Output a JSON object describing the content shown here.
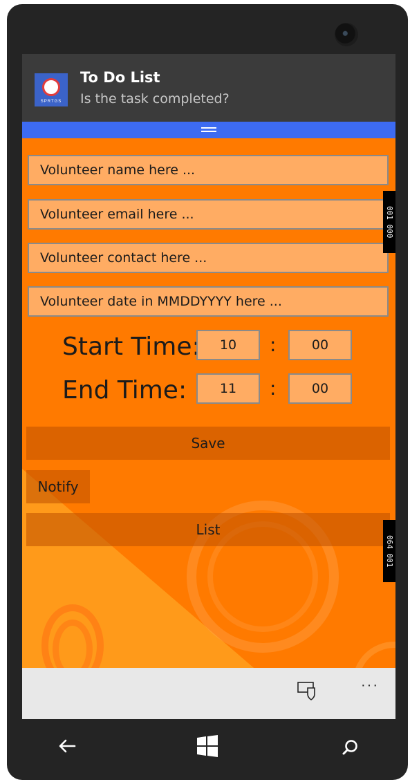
{
  "notification": {
    "title": "To Do List",
    "message": "Is the task completed?",
    "logo_text": "SPRTGS"
  },
  "form": {
    "name_placeholder": "Volunteer name here ...",
    "email_placeholder": "Volunteer email here ...",
    "contact_placeholder": "Volunteer contact here ...",
    "date_placeholder": "Volunteer date in MMDDYYYY here ...",
    "start_label": "Start Time:",
    "end_label": "End Time:",
    "start_hour": "10",
    "start_minute": "00",
    "end_hour": "11",
    "end_minute": "00",
    "separator": ":"
  },
  "buttons": {
    "save": "Save",
    "notify": "Notify",
    "list": "List"
  },
  "debug_counters": {
    "top": "001 000",
    "bottom": "064 001"
  },
  "appbar": {
    "more_label": "···"
  },
  "colors": {
    "accent_orange": "#ff7a00",
    "notification_bar": "#3d6bf2"
  },
  "icons": [
    "shield-icon",
    "more-icon",
    "back-arrow-icon",
    "windows-start-icon",
    "search-icon"
  ]
}
